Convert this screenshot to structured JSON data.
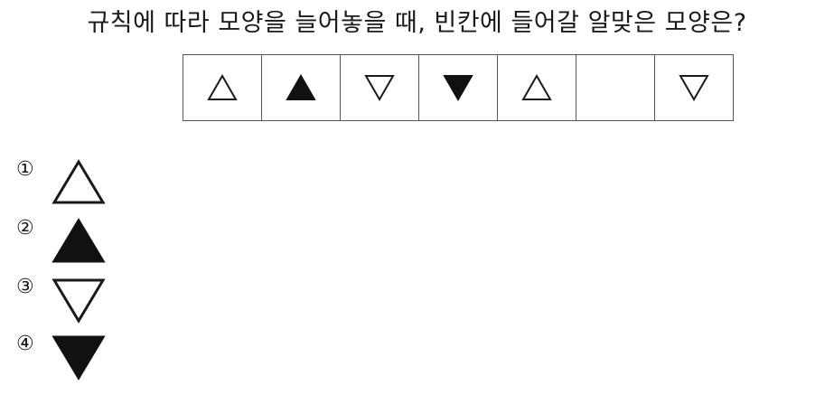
{
  "question": "규칙에 따라 모양을 늘어놓을 때, 빈칸에 들어갈 알맞은 모양은?",
  "sequence": [
    {
      "shape": "triangle-up",
      "fill": "white"
    },
    {
      "shape": "triangle-up",
      "fill": "black"
    },
    {
      "shape": "triangle-down",
      "fill": "white"
    },
    {
      "shape": "triangle-down",
      "fill": "black"
    },
    {
      "shape": "triangle-up",
      "fill": "white"
    },
    {
      "shape": "blank",
      "fill": "none"
    },
    {
      "shape": "triangle-down",
      "fill": "white"
    }
  ],
  "options": [
    {
      "number": "①",
      "shape": "triangle-up",
      "fill": "white"
    },
    {
      "number": "②",
      "shape": "triangle-up",
      "fill": "black"
    },
    {
      "number": "③",
      "shape": "triangle-down",
      "fill": "white"
    },
    {
      "number": "④",
      "shape": "triangle-down",
      "fill": "black"
    }
  ],
  "colors": {
    "stroke": "#1a1a1a",
    "black_fill": "#111111",
    "white_fill": "#ffffff"
  }
}
